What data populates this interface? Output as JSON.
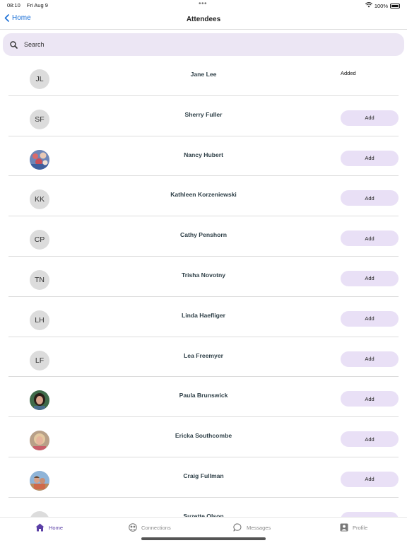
{
  "status": {
    "time": "08:10",
    "date": "Fri Aug 9",
    "battery": "100%"
  },
  "nav": {
    "back_label": "Home",
    "title": "Attendees"
  },
  "search": {
    "placeholder": "Search"
  },
  "attendees": [
    {
      "name": "Jane Lee",
      "initials": "JL",
      "action": "Added",
      "photo": ""
    },
    {
      "name": "Sherry Fuller",
      "initials": "SF",
      "action": "Add",
      "photo": ""
    },
    {
      "name": "Nancy Hubert",
      "initials": "",
      "action": "Add",
      "photo": "group-photo"
    },
    {
      "name": "Kathleen Korzeniewski",
      "initials": "KK",
      "action": "Add",
      "photo": ""
    },
    {
      "name": "Cathy Penshorn",
      "initials": "CP",
      "action": "Add",
      "photo": ""
    },
    {
      "name": "Trisha Novotny",
      "initials": "TN",
      "action": "Add",
      "photo": ""
    },
    {
      "name": "Linda Haefliger",
      "initials": "LH",
      "action": "Add",
      "photo": ""
    },
    {
      "name": "Lea Freemyer",
      "initials": "LF",
      "action": "Add",
      "photo": ""
    },
    {
      "name": "Paula Brunswick",
      "initials": "",
      "action": "Add",
      "photo": "portrait-dark-hair"
    },
    {
      "name": "Ericka Southcombe",
      "initials": "",
      "action": "Add",
      "photo": "portrait-blonde"
    },
    {
      "name": "Craig Fullman",
      "initials": "",
      "action": "Add",
      "photo": "portrait-couple-outdoor"
    },
    {
      "name": "Suzette Olson",
      "initials": "",
      "action": "Add",
      "photo": ""
    }
  ],
  "tabs": [
    {
      "label": "Home",
      "icon": "home-icon",
      "active": true
    },
    {
      "label": "Connections",
      "icon": "connections-icon",
      "active": false
    },
    {
      "label": "Messages",
      "icon": "messages-icon",
      "active": false
    },
    {
      "label": "Profile",
      "icon": "profile-icon",
      "active": false
    }
  ],
  "colors": {
    "accent": "#1a6fd6",
    "active_tab": "#5b3fa6",
    "button_bg": "#e9e0f6",
    "search_bg": "#ece6f4",
    "avatar_bg": "#dcdcdc"
  }
}
